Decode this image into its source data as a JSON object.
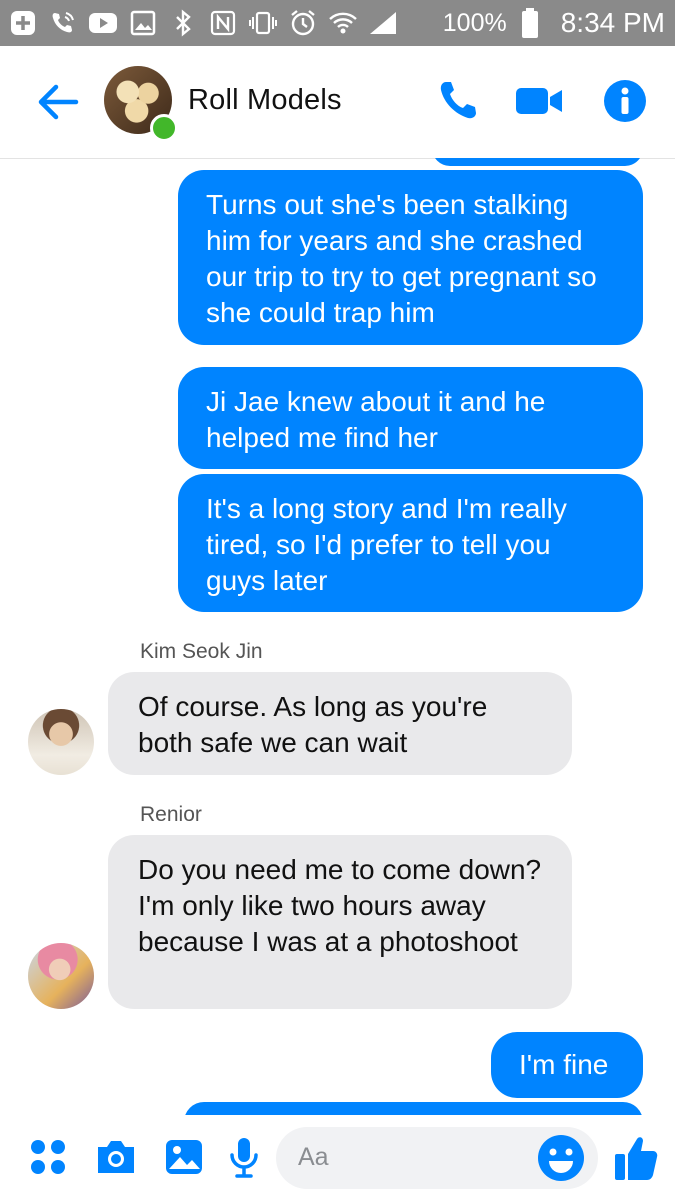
{
  "status_bar": {
    "battery": "100%",
    "time": "8:34 PM",
    "icons": [
      "plus-box-icon",
      "wifi-call-icon",
      "youtube-icon",
      "image-icon",
      "bluetooth-icon",
      "nfc-icon",
      "vibrate-icon",
      "alarm-icon",
      "wifi-icon",
      "signal-icon",
      "battery-icon"
    ]
  },
  "header": {
    "title": "Roll Models",
    "icons": [
      "back-arrow-icon",
      "phone-icon",
      "video-call-icon",
      "info-icon"
    ]
  },
  "messages": [
    {
      "from": "me",
      "text": "Turns out she's been stalking him for years and she crashed our trip to try to get pregnant so she could trap him"
    },
    {
      "from": "me",
      "text": "Ji Jae knew about it and he helped me find her"
    },
    {
      "from": "me",
      "text": "It's a long story and I'm really tired, so I'd prefer to tell you guys later"
    },
    {
      "from": "Kim Seok Jin",
      "sender": "Kim Seok Jin",
      "text": "Of course. As long as you're both safe we can wait"
    },
    {
      "from": "Renior",
      "sender": "Renior",
      "text": "Do you need me to come down? I'm only like two hours away because I was at a photoshoot"
    },
    {
      "from": "me",
      "text": "I'm fine"
    }
  ],
  "composer": {
    "placeholder": "Aa",
    "icons": [
      "apps-icon",
      "camera-icon",
      "gallery-icon",
      "microphone-icon",
      "emoji-icon",
      "like-thumb-icon"
    ]
  },
  "colors": {
    "accent": "#0084ff",
    "incoming_bubble": "#e9e9eb",
    "status_bar": "#8a8a8a",
    "online": "#42b72a"
  }
}
